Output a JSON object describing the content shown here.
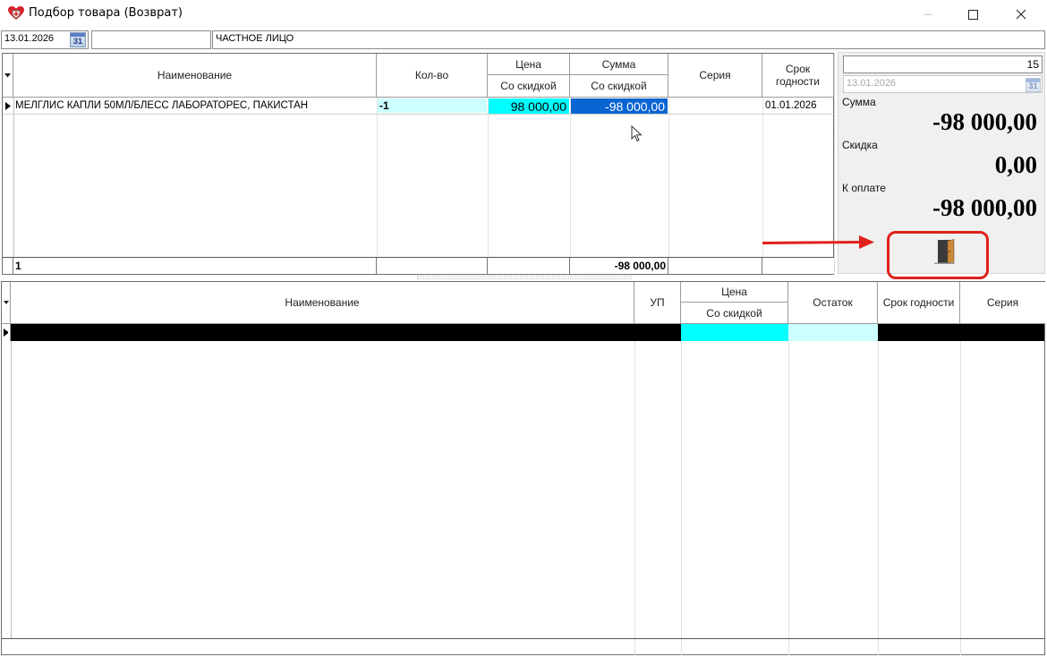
{
  "window": {
    "title": "Подбор товара (Возврат)",
    "icon": "heart-shield-app-icon",
    "controls": [
      "minimize",
      "maximize",
      "close"
    ]
  },
  "top_fields": {
    "date": "13.01.2026",
    "calendar_day": "31",
    "code": "",
    "client": "ЧАСТНОЕ ЛИЦО"
  },
  "upper_grid": {
    "columns": {
      "name": "Наименование",
      "qty": "Кол-во",
      "price_top": "Цена",
      "price_sub": "Со скидкой",
      "sum_top": "Сумма",
      "sum_sub": "Со скидкой",
      "series": "Серия",
      "expiry": "Срок годности"
    },
    "rows": [
      {
        "name": "МЕЛГЛИС КАПЛИ 50МЛ/БЛЕСС ЛАБОРАТОРЕС, ПАКИСТАН",
        "qty": "-1",
        "price": "98 000,00",
        "sum": "-98 000,00",
        "series": "",
        "expiry": "01.01.2026"
      }
    ],
    "footer": {
      "count": "1",
      "sum": "-98 000,00"
    }
  },
  "right_panel": {
    "counter": "15",
    "date": "13.01.2026",
    "calendar_day": "31",
    "sum_label": "Сумма",
    "sum_value": "-98 000,00",
    "discount_label": "Скидка",
    "discount_value": "0,00",
    "topay_label": "К оплате",
    "topay_value": "-98 000,00",
    "exit_icon": "door-exit-icon"
  },
  "lower_grid": {
    "columns": {
      "name": "Наименование",
      "up": "УП",
      "price_top": "Цена",
      "price_sub": "Со скидкой",
      "stock": "Остаток",
      "expiry": "Срок годности",
      "series": "Серия"
    }
  },
  "colors": {
    "highlight_cyan": "#00ffff",
    "light_cyan": "#ccffff",
    "selected_blue": "#0a64d2",
    "annotation_red": "#e0201c",
    "panel_gray": "#f0f0f0"
  }
}
